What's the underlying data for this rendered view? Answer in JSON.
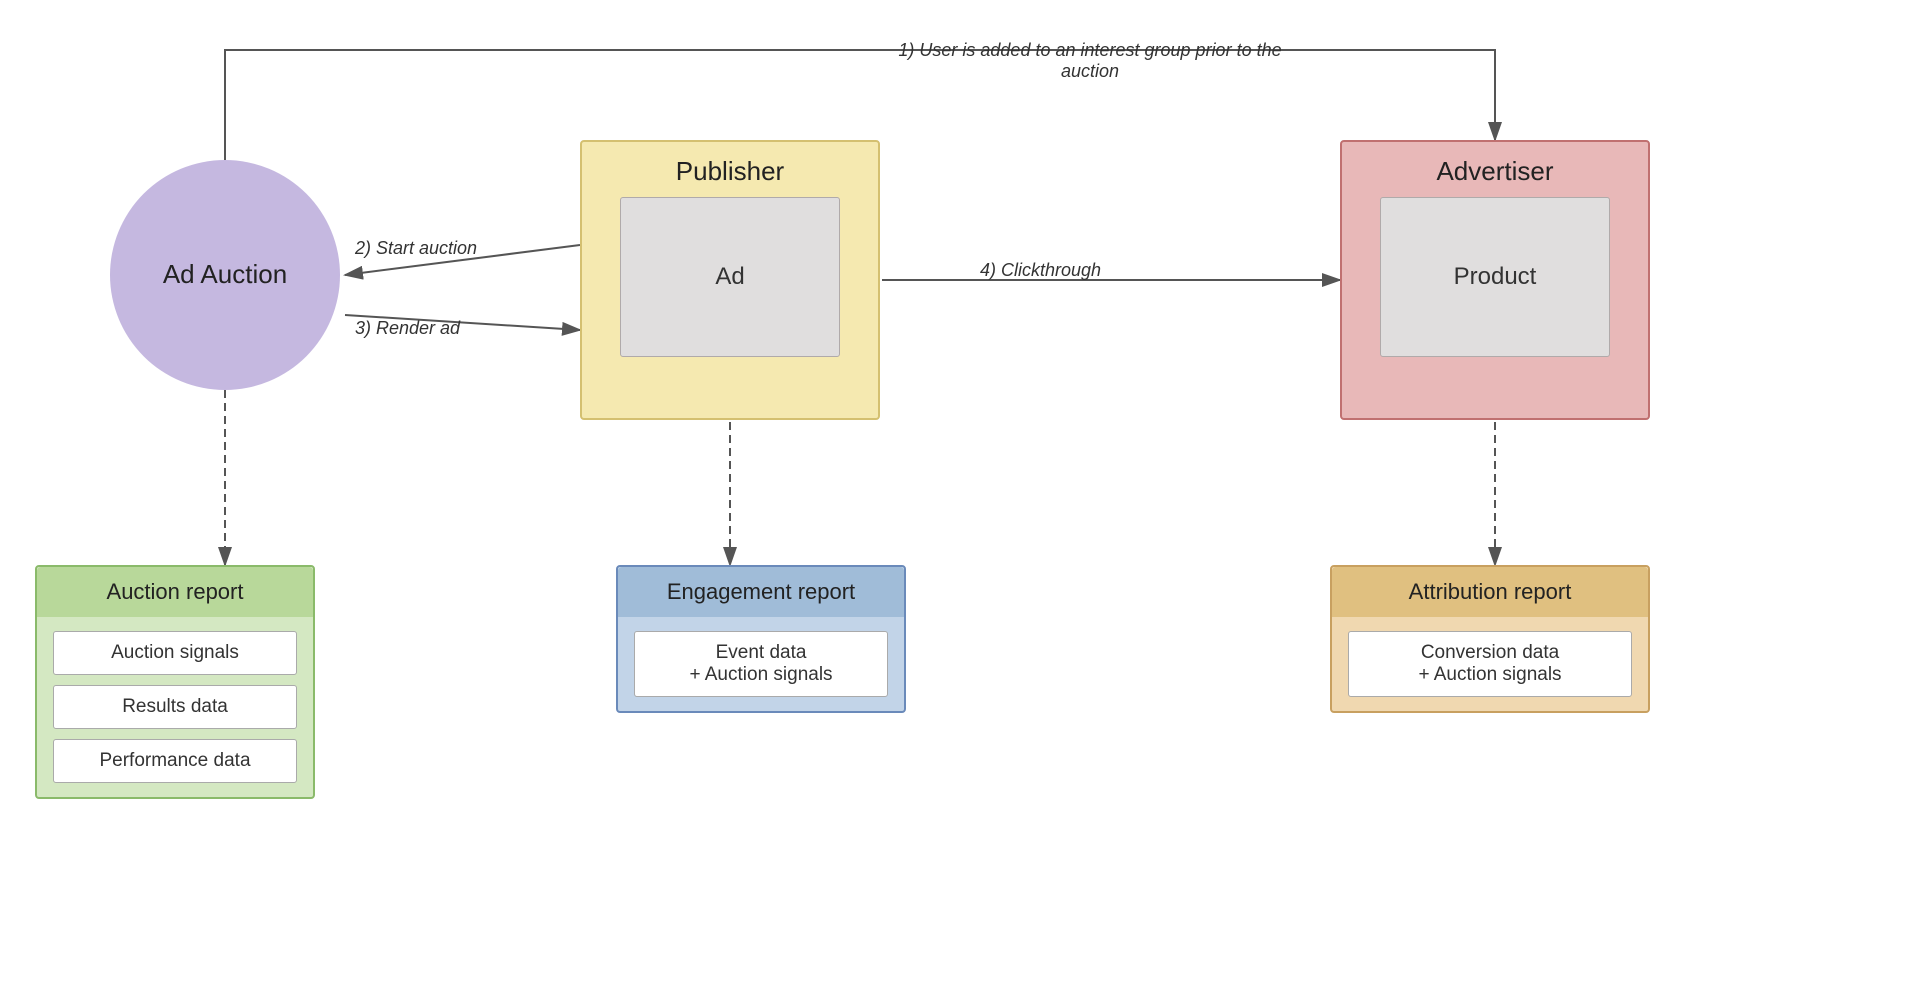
{
  "adAuction": {
    "label": "Ad\nAuction"
  },
  "publisher": {
    "title": "Publisher",
    "inner": "Ad"
  },
  "advertiser": {
    "title": "Advertiser",
    "inner": "Product"
  },
  "annotations": {
    "userAdded": "1) User is added to an interest\ngroup prior to the auction",
    "startAuction": "2) Start auction",
    "renderAd": "3) Render ad",
    "clickthrough": "4) Clickthrough"
  },
  "auctionReport": {
    "header": "Auction report",
    "items": [
      "Auction signals",
      "Results data",
      "Performance data"
    ]
  },
  "engagementReport": {
    "header": "Engagement report",
    "items": [
      "Event data\n+ Auction signals"
    ]
  },
  "attributionReport": {
    "header": "Attribution report",
    "items": [
      "Conversion data\n+ Auction signals"
    ]
  }
}
